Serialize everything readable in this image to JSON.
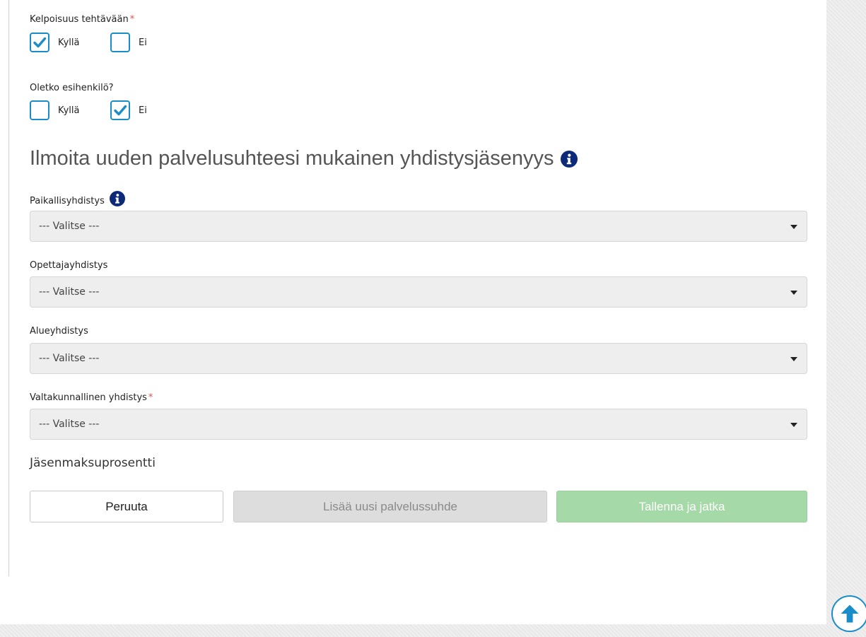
{
  "questions": [
    {
      "label": "Kelpoisuus tehtävään",
      "required_mark": "*",
      "options": [
        {
          "label": "Kyllä",
          "checked": true
        },
        {
          "label": "Ei",
          "checked": false
        }
      ]
    },
    {
      "label": "Oletko esihenkilö?",
      "required_mark": "",
      "options": [
        {
          "label": "Kyllä",
          "checked": false
        },
        {
          "label": "Ei",
          "checked": true
        }
      ]
    }
  ],
  "membership": {
    "title": "Ilmoita uuden palvelusuhteesi mukainen yhdistysjäsenyys",
    "title_icon": "info-icon",
    "fields": [
      {
        "label": "Paikallisyhdistys",
        "required_mark": "",
        "has_info_icon": true,
        "value": "--- Valitse ---"
      },
      {
        "label": "Opettajayhdistys",
        "required_mark": "",
        "has_info_icon": false,
        "value": "--- Valitse ---"
      },
      {
        "label": "Alueyhdistys",
        "required_mark": "",
        "has_info_icon": false,
        "value": "--- Valitse ---"
      },
      {
        "label": "Valtakunnallinen yhdistys",
        "required_mark": "*",
        "has_info_icon": false,
        "value": "--- Valitse ---"
      }
    ],
    "fee_label": "Jäsenmaksuprosentti"
  },
  "buttons": {
    "cancel": "Peruuta",
    "add": "Lisää uusi palvelussuhde",
    "save": "Tallenna ja jatka"
  },
  "icons": {
    "checkmark": "checkmark-icon",
    "info": "info-icon",
    "caret": "caret-down-icon",
    "back_to_top": "arrow-up-icon"
  },
  "colors": {
    "accent": "#1a8cc7",
    "required": "#d9534f",
    "info_icon": "#0d2a78",
    "save_button": "#a6d9a8",
    "disabled_button": "#dddddd",
    "select_bg": "#eeeeee"
  }
}
